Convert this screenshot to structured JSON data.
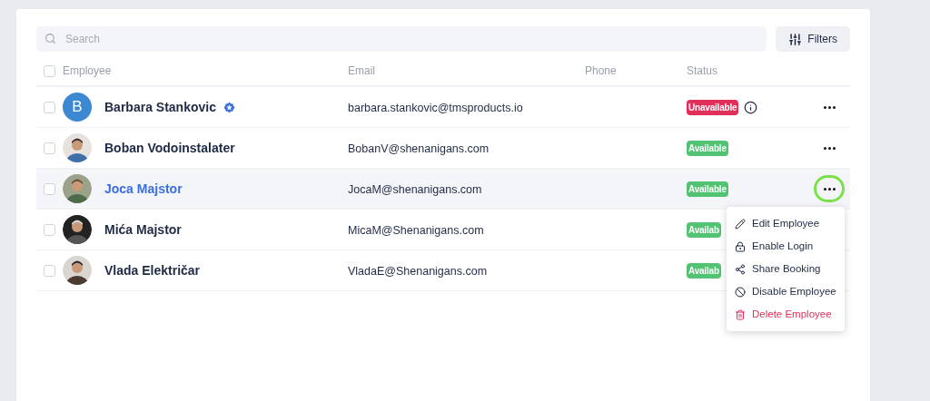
{
  "search": {
    "placeholder": "Search"
  },
  "filters_button": {
    "label": "Filters"
  },
  "columns": [
    "Employee",
    "Email",
    "Phone",
    "Status"
  ],
  "rows": [
    {
      "avatar": {
        "kind": "letter",
        "letter": "B"
      },
      "name": "Barbara Stankovic",
      "verified": true,
      "email": "barbara.stankovic@tmsproducts.io",
      "status": {
        "kind": "unavailable",
        "label": "Unavailable"
      },
      "info": true,
      "checked": false,
      "selected": false,
      "actions_hidden": false
    },
    {
      "name": "Boban Vodoinstalater",
      "verified": false,
      "email": "BobanV@shenanigans.com",
      "status": {
        "kind": "available",
        "label": "Available"
      },
      "info": false,
      "checked": false,
      "selected": false,
      "actions_hidden": false
    },
    {
      "name": "Joca Majstor",
      "verified": false,
      "email": "JocaM@shenanigans.com",
      "status": {
        "kind": "available",
        "label": "Available"
      },
      "info": false,
      "checked": false,
      "selected": true,
      "actions_hidden": false,
      "menu": [
        {
          "label": "Edit Employee",
          "kind": "normal"
        },
        {
          "label": "Enable Login",
          "kind": "normal"
        },
        {
          "label": "Share Booking",
          "kind": "normal"
        },
        {
          "label": "Disable Employee",
          "kind": "normal"
        },
        {
          "label": "Delete Employee",
          "kind": "danger"
        }
      ]
    },
    {
      "name": "Mića Majstor",
      "verified": false,
      "email": "MicaM@Shenanigans.com",
      "status": {
        "kind": "available",
        "label": "Availab"
      },
      "info": false,
      "checked": false,
      "selected": false,
      "actions_hidden": true
    },
    {
      "name": "Vlada Električar",
      "verified": false,
      "email": "VladaE@Shenanigans.com",
      "status": {
        "kind": "available",
        "label": "Availab"
      },
      "info": false,
      "checked": false,
      "selected": false,
      "actions_hidden": true
    }
  ],
  "header_checkbox": {
    "checked": false
  }
}
